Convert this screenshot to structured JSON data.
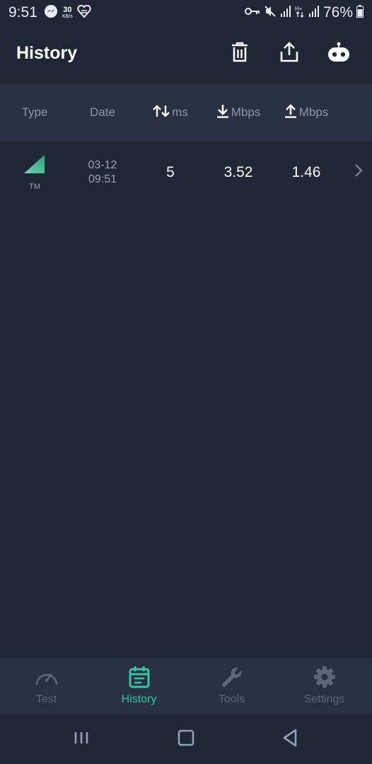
{
  "status_bar": {
    "time": "9:51",
    "data_rate_value": "30",
    "data_rate_unit": "KB/s",
    "battery_percent": "76%"
  },
  "app_bar": {
    "title": "History",
    "actions": [
      "trash-icon",
      "share-icon",
      "robot-icon"
    ]
  },
  "table": {
    "headers": {
      "type": "Type",
      "date": "Date",
      "ping": "ms",
      "download": "Mbps",
      "upload": "Mbps"
    },
    "rows": [
      {
        "type_label": "TM",
        "date": "03-12",
        "time": "09:51",
        "ping": "5",
        "download": "3.52",
        "upload": "1.46"
      }
    ]
  },
  "bottom_nav": {
    "items": [
      {
        "label": "Test",
        "icon": "speedometer-icon"
      },
      {
        "label": "History",
        "icon": "calendar-icon",
        "active": true
      },
      {
        "label": "Tools",
        "icon": "wrench-icon"
      },
      {
        "label": "Settings",
        "icon": "gear-icon"
      }
    ]
  },
  "colors": {
    "background": "#1f2636",
    "header_band": "#283143",
    "accent": "#35c6a5",
    "muted_text": "#8e97a8"
  }
}
